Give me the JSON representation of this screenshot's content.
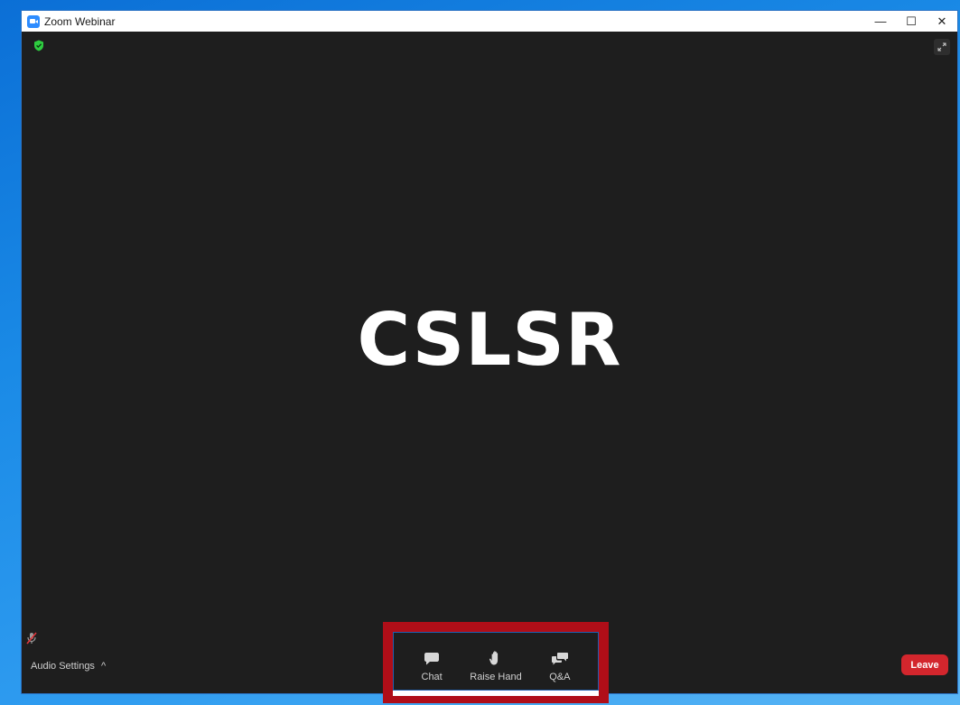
{
  "window": {
    "title": "Zoom Webinar",
    "controls": {
      "minimize": "—",
      "maximize": "☐",
      "close": "✕"
    }
  },
  "stage": {
    "shared_text": "CSLSR",
    "shield_color": "#2ecc40"
  },
  "bottom_bar": {
    "audio_settings_label": "Audio Settings",
    "audio_settings_caret": "^",
    "tools": [
      {
        "label": "Chat",
        "icon": "chat-icon"
      },
      {
        "label": "Raise Hand",
        "icon": "hand-icon"
      },
      {
        "label": "Q&A",
        "icon": "qa-icon"
      }
    ],
    "leave_label": "Leave",
    "leave_color": "#d3262d"
  }
}
